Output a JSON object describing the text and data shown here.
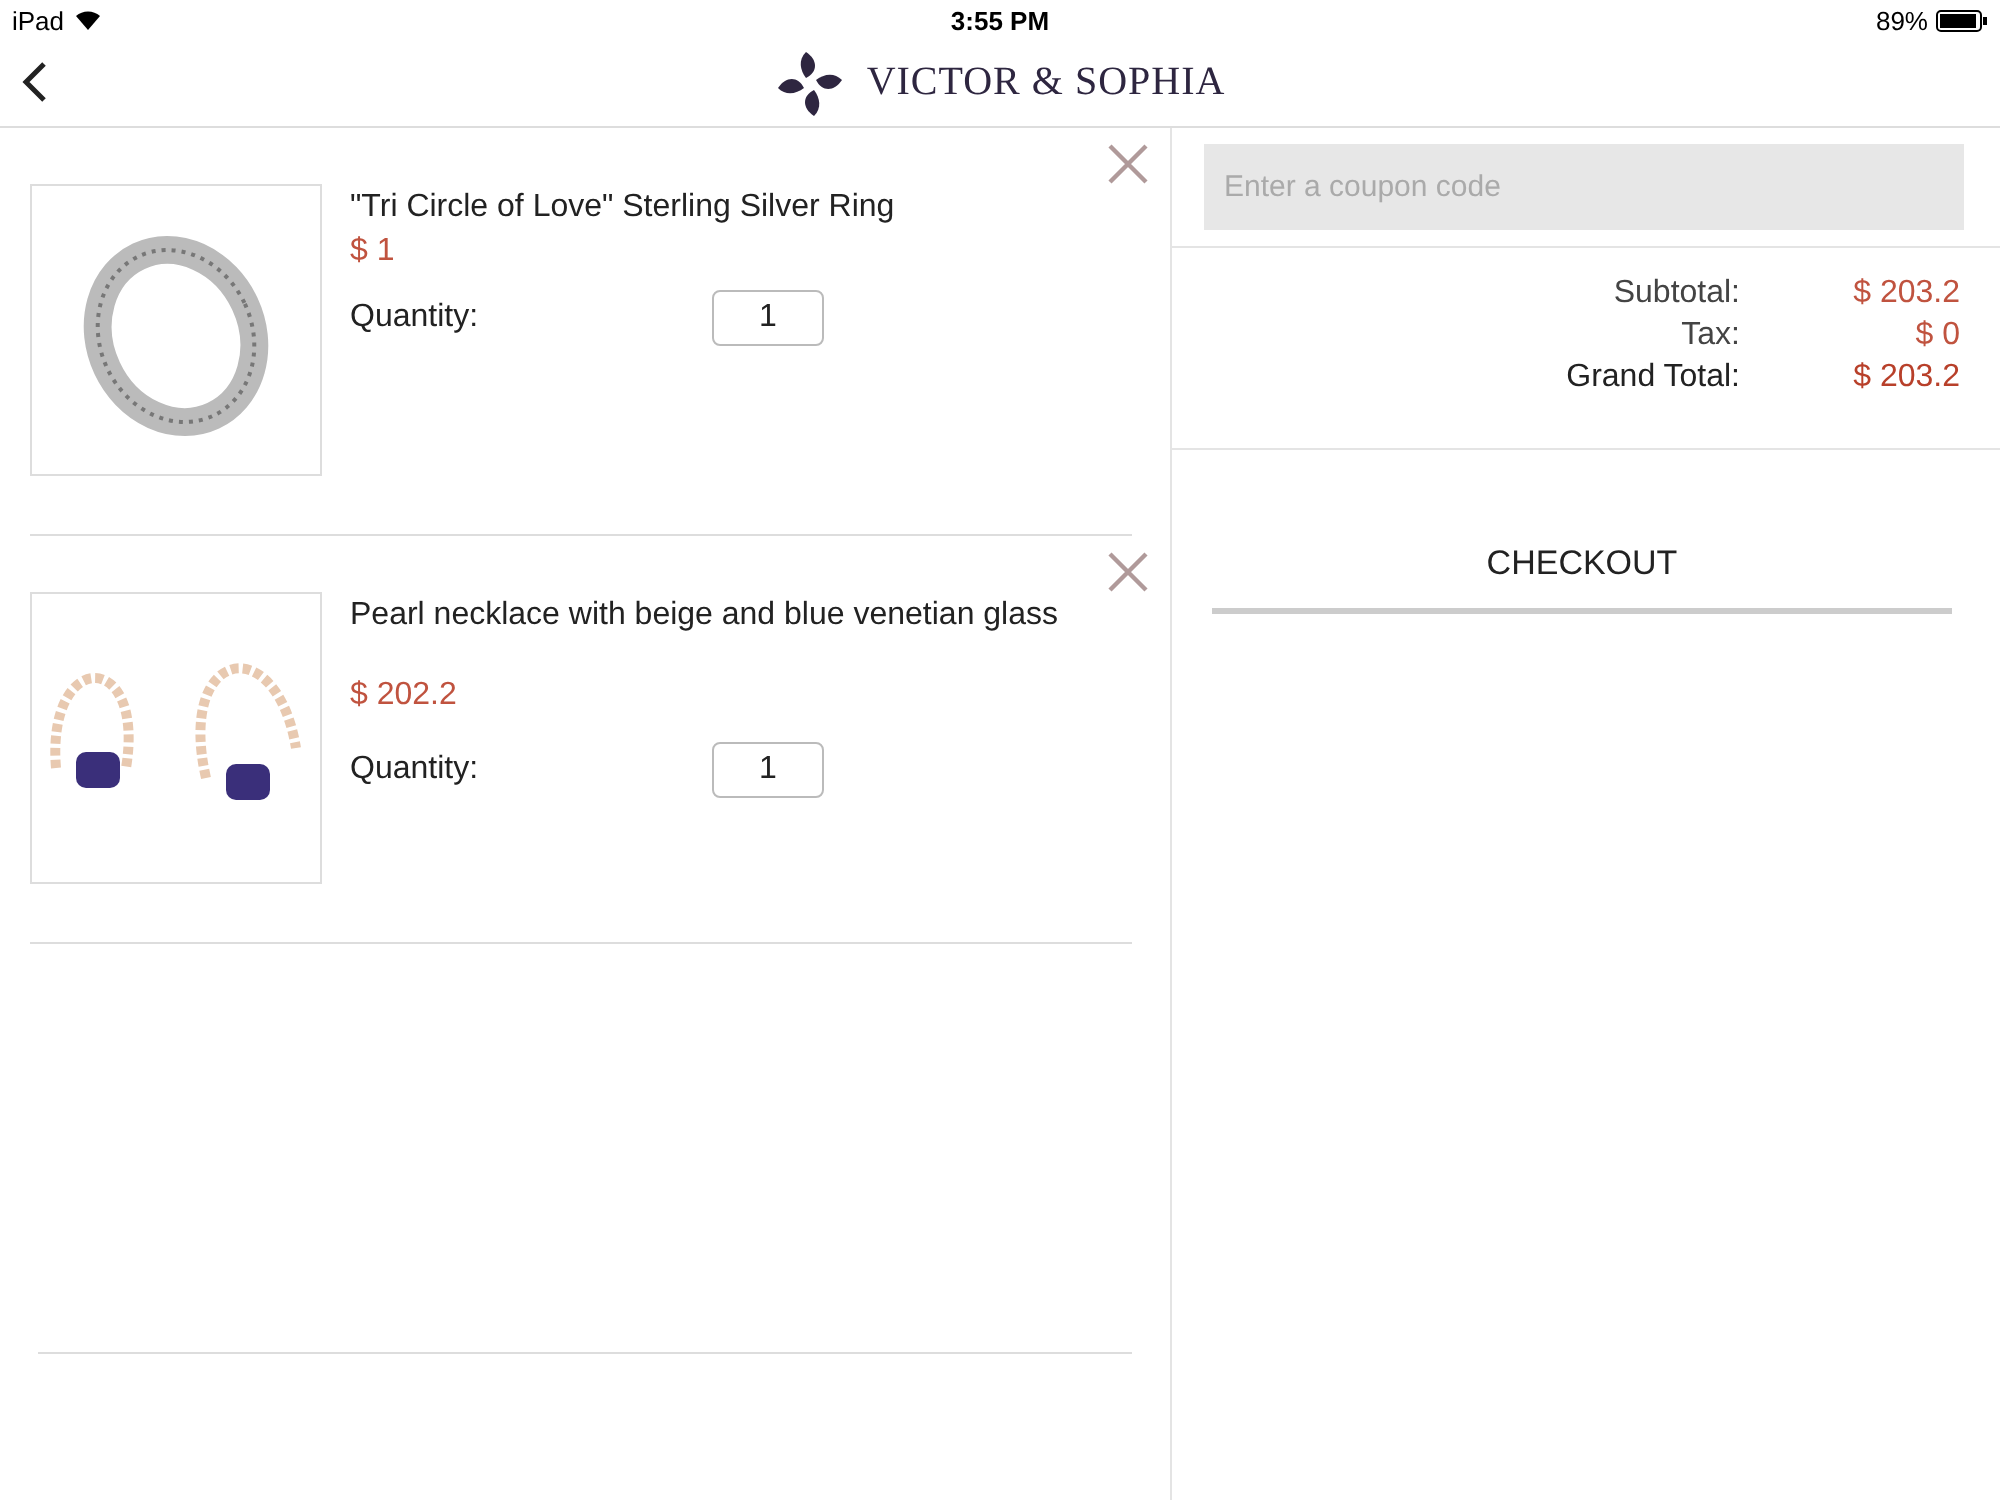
{
  "status_bar": {
    "carrier": "iPad",
    "time": "3:55 PM",
    "battery": "89%"
  },
  "nav": {
    "brand": "VICTOR & SOPHIA"
  },
  "cart_items": [
    {
      "name": "\"Tri Circle of Love\" Sterling Silver Ring",
      "price": "$ 1",
      "quantity_label": "Quantity:",
      "quantity": "1",
      "kind": "ring"
    },
    {
      "name": "Pearl necklace with beige and blue venetian glass",
      "price": "$ 202.2",
      "quantity_label": "Quantity:",
      "quantity": "1",
      "kind": "necklace"
    }
  ],
  "coupon": {
    "placeholder": "Enter a coupon code"
  },
  "totals": [
    {
      "label": "Subtotal:",
      "value": "$ 203.2",
      "strong": false
    },
    {
      "label": "Tax:",
      "value": "$ 0",
      "strong": false
    },
    {
      "label": "Grand Total:",
      "value": "$ 203.2",
      "strong": true
    }
  ],
  "checkout": {
    "label": "CHECKOUT"
  }
}
